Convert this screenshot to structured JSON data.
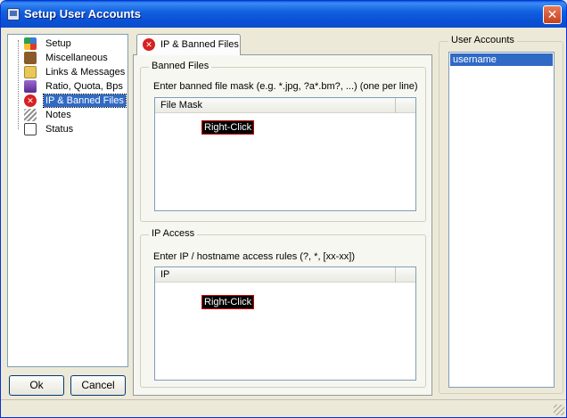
{
  "window": {
    "title": "Setup User Accounts",
    "close_glyph": "✕"
  },
  "tree": {
    "items": [
      {
        "label": "Setup",
        "icon": "setup-icon",
        "color": "#3a7ad8"
      },
      {
        "label": "Miscellaneous",
        "icon": "misc-icon",
        "color": "#8a5a2a"
      },
      {
        "label": "Links & Messages",
        "icon": "folder-icon",
        "color": "#e8c85a"
      },
      {
        "label": "Ratio, Quota, Bps",
        "icon": "ratio-icon",
        "color": "#7a4ab0"
      },
      {
        "label": "IP & Banned Files",
        "icon": "banned-icon",
        "color": "#d82020",
        "selected": true
      },
      {
        "label": "Notes",
        "icon": "notes-icon",
        "color": "#707070"
      },
      {
        "label": "Status",
        "icon": "status-icon",
        "color": "#404040"
      }
    ]
  },
  "buttons": {
    "ok": "Ok",
    "cancel": "Cancel"
  },
  "tab": {
    "label": "IP & Banned Files",
    "icon_glyph": "✕"
  },
  "banned_files": {
    "title": "Banned Files",
    "hint": "Enter banned file mask (e.g. *.jpg, ?a*.bm?, ...) (one per line)",
    "column": "File Mask",
    "context_hint": "Right-Click"
  },
  "ip_access": {
    "title": "IP Access",
    "hint": "Enter IP / hostname access rules (?, *, [xx-xx])",
    "column": "IP",
    "context_hint": "Right-Click"
  },
  "user_accounts": {
    "title": "User Accounts",
    "items": [
      "username"
    ]
  },
  "colors": {
    "selection": "#316ac5",
    "titlebar": "#0a52d6"
  }
}
